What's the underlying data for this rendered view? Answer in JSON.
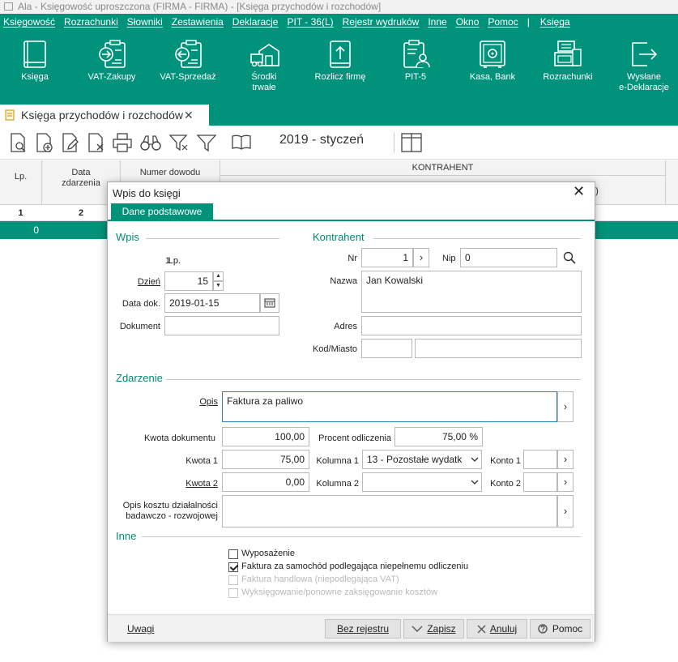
{
  "window": {
    "title": "Ala - Księgowość uproszczona (FIRMA - FIRMA) - [Księga przychodów i rozchodów]"
  },
  "menu": [
    "Księgowość",
    "Rozrachunki",
    "Słowniki",
    "Zestawienia",
    "Deklaracje",
    "PIT - 36(L)",
    "Rejestr wydruków",
    "Inne",
    "Okno",
    "Pomoc",
    "|",
    "Księga"
  ],
  "ribbon": {
    "ksiega": "Księga",
    "vat_zakupy": "VAT-Zakupy",
    "vat_sprzedaz": "VAT-Sprzedaż",
    "srodki_1": "Środki",
    "srodki_2": "trwałe",
    "rozlicz": "Rozlicz firmę",
    "pit5": "PIT-5",
    "kasa": "Kasa, Bank",
    "rozrachunki": "Rozrachunki",
    "wyslane_1": "Wysłane",
    "wyslane_2": "e-Deklaracje"
  },
  "doc_tab": {
    "label": "Księga przychodów i rozchodów",
    "close": "✕"
  },
  "toolbar": {
    "period": "2019 - styczeń"
  },
  "grid": {
    "col_lp": "Lp.",
    "col_data_1": "Data",
    "col_data_2": "zdarzenia",
    "col_numer": "Numer dowodu",
    "col_kontrahent": "KONTRAHENT",
    "row1_lp": "1",
    "row1_data": "2",
    "row2_lp": "0",
    "partial_text": ")"
  },
  "dialog": {
    "title": "Wpis do księgi",
    "close": "✕",
    "tab": "Dane podstawowe",
    "wpis": {
      "section": "Wpis",
      "lp_label": "Lp.",
      "lp_value": "1",
      "dzien_label": "Dzień",
      "dzien_value": "15",
      "data_label": "Data dok.",
      "data_value": "2019-01-15",
      "dokument_label": "Dokument",
      "dokument_value": ""
    },
    "kontrahent": {
      "section": "Kontrahent",
      "nr_label": "Nr",
      "nr_value": "1",
      "nip_label": "Nip",
      "nip_value": "0",
      "nazwa_label": "Nazwa",
      "nazwa_value": "Jan Kowalski",
      "adres_label": "Adres",
      "adres_value": "",
      "kod_label": "Kod/Miasto",
      "kod_value": "",
      "miasto_value": ""
    },
    "zdarzenie": {
      "section": "Zdarzenie",
      "opis_label": "Opis",
      "opis_value": "Faktura za paliwo",
      "kwota_dok_label": "Kwota dokumentu",
      "kwota_dok_value": "100,00",
      "procent_label": "Procent odliczenia",
      "procent_value": "75,00 %",
      "kwota1_label": "Kwota 1",
      "kwota1_value": "75,00",
      "kolumna1_label": "Kolumna 1",
      "kolumna1_value": "13 - Pozostałe wydatk",
      "konto1_label": "Konto 1",
      "konto1_value": "",
      "kwota2_label": "Kwota 2",
      "kwota2_value": "0,00",
      "kolumna2_label": "Kolumna 2",
      "kolumna2_value": "",
      "konto2_label": "Konto 2",
      "konto2_value": "",
      "opis_br_label_1": "Opis kosztu działalności",
      "opis_br_label_2": "badawczo - rozwojowej",
      "opis_br_value": ""
    },
    "inne": {
      "section": "Inne",
      "wyposazenie": "Wyposażenie",
      "faktura_samochod": "Faktura za samochód podlegająca niepełnemu odliczeniu",
      "faktura_handlowa": "Faktura handlowa (niepodlegająca VAT)",
      "wyksiegowanie": "Wyksięgowanie/ponowne zaksięgowanie kosztów"
    },
    "footer": {
      "uwagi": "Uwagi",
      "bez_rejestru": "Bez rejestru",
      "zapisz": "Zapisz",
      "anuluj": "Anuluj",
      "pomoc": "Pomoc"
    }
  },
  "colors": {
    "accent": "#00927a",
    "section": "#008a73"
  }
}
